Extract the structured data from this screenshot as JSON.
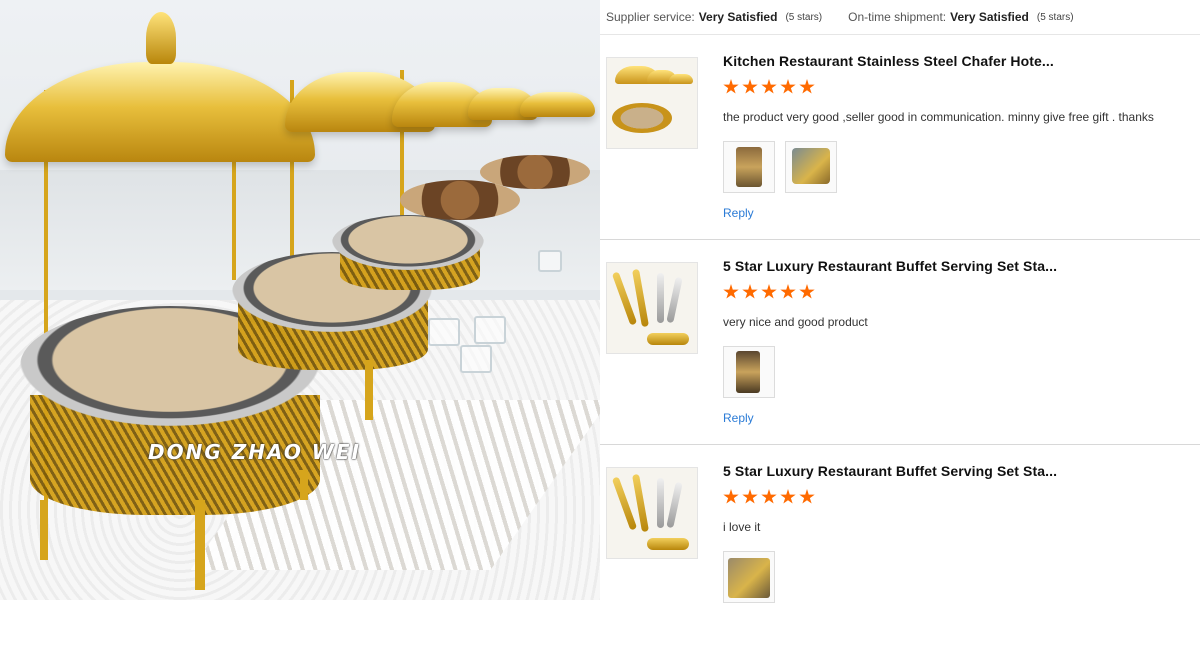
{
  "photo": {
    "watermark": "DONG ZHAO WEI",
    "colors": {
      "gold": "#d4a017",
      "cloth": "#f2f2f2"
    }
  },
  "summary": {
    "supplier_label": "Supplier service:",
    "supplier_value": "Very Satisfied",
    "supplier_stars": "(5 stars)",
    "shipment_label": "On-time shipment:",
    "shipment_value": "Very Satisfied",
    "shipment_stars": "(5 stars)"
  },
  "reviews": [
    {
      "product_title": "Kitchen Restaurant Stainless Steel Chafer Hote...",
      "rating": 5,
      "comment": "the product very good ,seller good in communication. minny give free gift . thanks",
      "attachments": 2,
      "reply_label": "Reply"
    },
    {
      "product_title": "5 Star Luxury Restaurant Buffet Serving Set Sta...",
      "rating": 5,
      "comment": "very nice and good product",
      "attachments": 1,
      "reply_label": "Reply"
    },
    {
      "product_title": "5 Star Luxury Restaurant Buffet Serving Set Sta...",
      "rating": 5,
      "comment": "i love it",
      "attachments": 1,
      "reply_label": ""
    }
  ],
  "colors": {
    "star": "#ff6a00",
    "link": "#2b7bd6",
    "divider": "#d8d8d8"
  }
}
